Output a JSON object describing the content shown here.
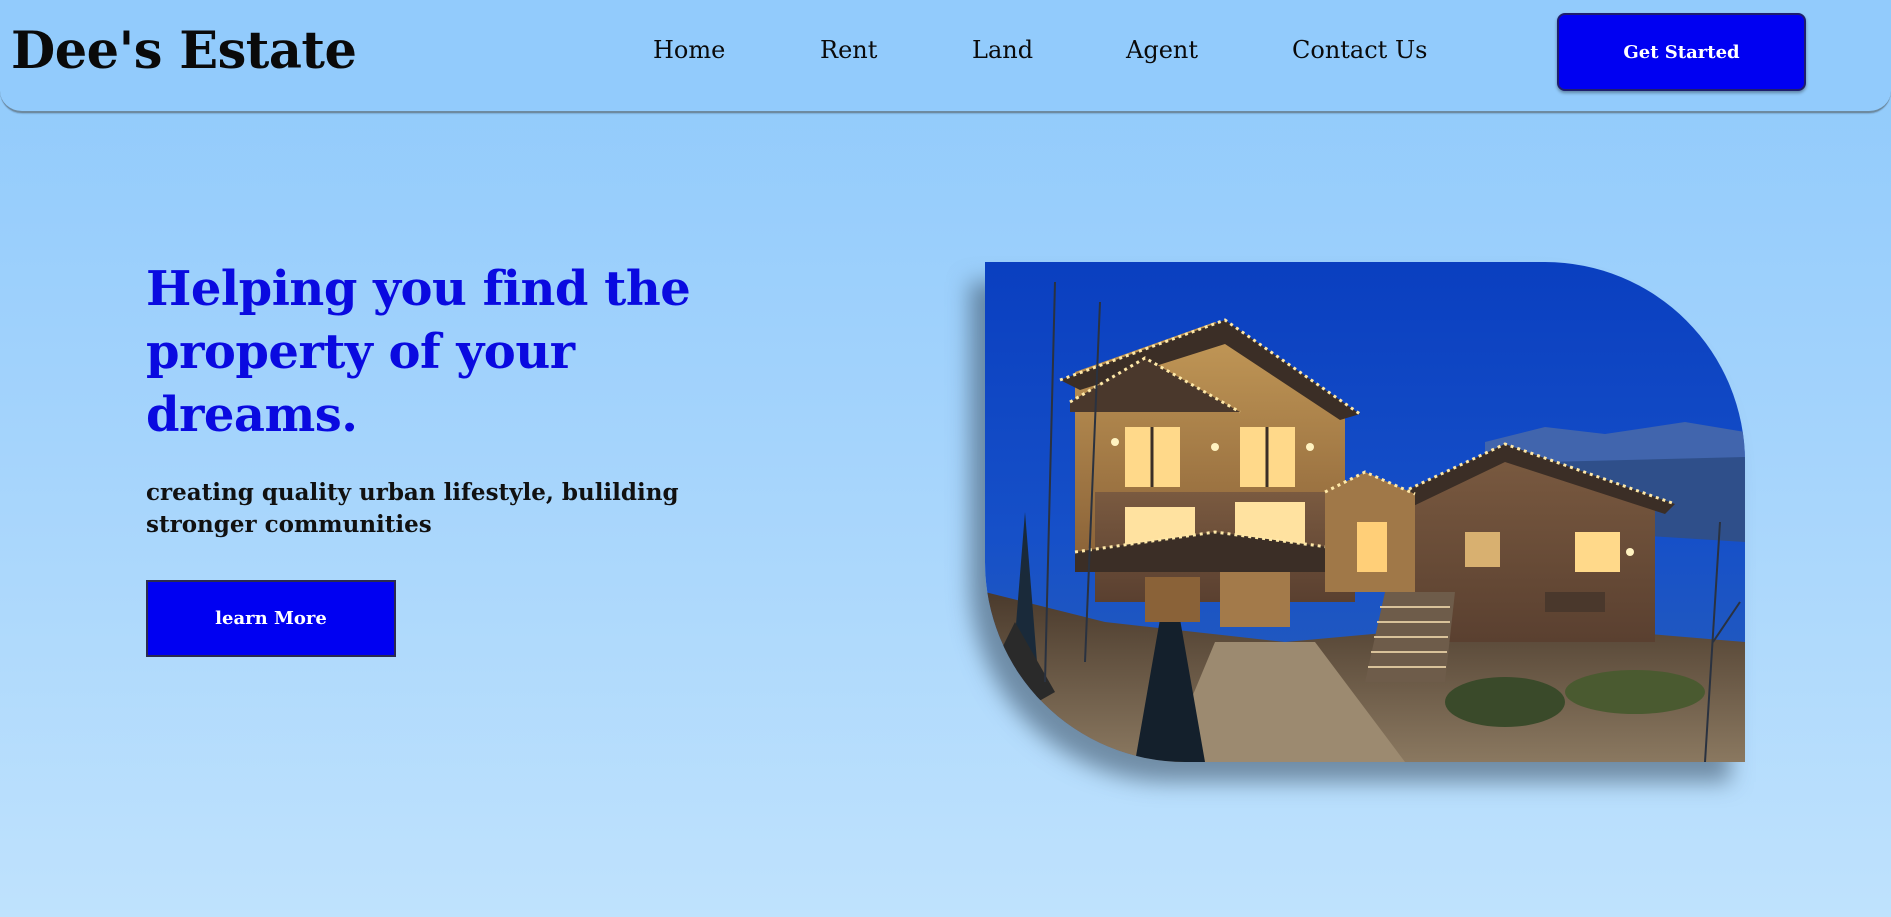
{
  "header": {
    "logo": "Dee's Estate",
    "nav": {
      "home": "Home",
      "rent": "Rent",
      "land": "Land",
      "agent": "Agent",
      "contact": "Contact Us"
    },
    "cta_label": "Get Started"
  },
  "hero": {
    "title": "Helping you find the property of your dreams.",
    "subtitle": "creating quality urban lifestyle, bulilding stronger communities",
    "button_label": "learn More",
    "image_icon": "house-photo"
  },
  "colors": {
    "background": "#92cbfc",
    "accent": "#0000f2",
    "heading": "#0a0ae0",
    "text": "#0a0a0a"
  }
}
